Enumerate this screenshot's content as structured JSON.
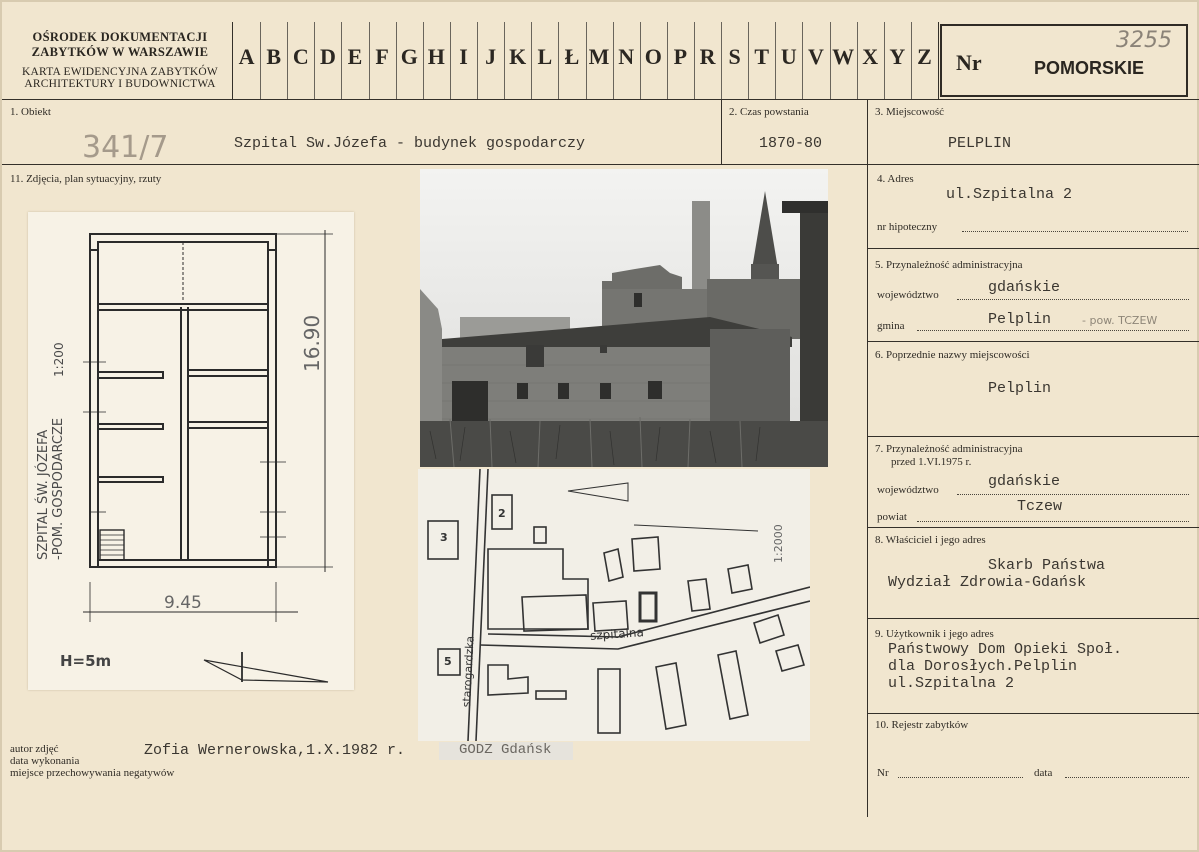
{
  "header": {
    "institution_line1": "OŚRODEK DOKUMENTACJI",
    "institution_line2": "ZABYTKÓW W WARSZAWIE",
    "card_type_line1": "KARTA EWIDENCYJNA ZABYTKÓW",
    "card_type_line2": "ARCHITEKTURY I BUDOWNICTWA",
    "alphabet": [
      "A",
      "B",
      "C",
      "D",
      "E",
      "F",
      "G",
      "H",
      "I",
      "J",
      "K",
      "L",
      "Ł",
      "M",
      "N",
      "O",
      "P",
      "R",
      "S",
      "T",
      "U",
      "V",
      "W",
      "X",
      "Y",
      "Z"
    ],
    "nr_label": "Nr",
    "region": "POMORSKIE",
    "handwritten_number": "3255"
  },
  "fields": {
    "obiekt": {
      "label": "1. Obiekt",
      "value": "Szpital Sw.Józefa - budynek gospodarczy",
      "handwritten": "341/7"
    },
    "czas": {
      "label": "2. Czas powstania",
      "value": "1870-80"
    },
    "miejscowosc": {
      "label": "3. Miejscowość",
      "value": "PELPLIN"
    },
    "zdjecia_label": "11. Zdjęcia, plan sytuacyjny, rzuty",
    "adres": {
      "label": "4. Adres",
      "value": "ul.Szpitalna 2",
      "hipoteczny_label": "nr hipoteczny"
    },
    "przynaleznosc": {
      "label": "5. Przynależność administracyjna",
      "wojewodztwo_label": "województwo",
      "wojewodztwo": "gdańskie",
      "gmina_label": "gmina",
      "gmina": "Pelplin",
      "gmina_note": "- pow. TCZEW"
    },
    "poprzednie": {
      "label": "6. Poprzednie nazwy miejscowości",
      "value": "Pelplin"
    },
    "przynaleznosc_1975": {
      "label_line1": "7. Przynależność administracyjna",
      "label_line2": "przed 1.VI.1975 r.",
      "wojewodztwo_label": "województwo",
      "wojewodztwo": "gdańskie",
      "powiat_label": "powiat",
      "powiat": "Tczew"
    },
    "wlasciciel": {
      "label": "8. Właściciel i jego adres",
      "line1": "Skarb Państwa",
      "line2": "Wydział Zdrowia-Gdańsk"
    },
    "uzytkownik": {
      "label": "9. Użytkownik i jego adres",
      "line1": "Państwowy Dom Opieki Społ.",
      "line2": "dla Dorosłych.Pelplin",
      "line3": "ul.Szpitalna 2"
    },
    "rejestr": {
      "label": "10. Rejestr zabytków",
      "nr_label": "Nr",
      "data_label": "data"
    }
  },
  "footer": {
    "autor_label": "autor zdjęć",
    "data_label": "data wykonania",
    "miejsce_label": "miejsce przechowywania negatywów",
    "autor_value": "Zofia Wernerowska,1.X.1982 r.",
    "godz": "GODZ  Gdańsk"
  },
  "plan": {
    "title_line1": "SZPITAL  ŚW. JÓZEFA",
    "title_line2": "-POM. GOSPODARCZE",
    "scale": "1:200",
    "width_dim": "9.45",
    "length_dim": "16.90",
    "height_note": "H=5m"
  },
  "site_map": {
    "scale": "1:2000",
    "street1": "szpitalna",
    "street2": "starogardzka",
    "parcels": [
      "2",
      "3",
      "5"
    ]
  }
}
